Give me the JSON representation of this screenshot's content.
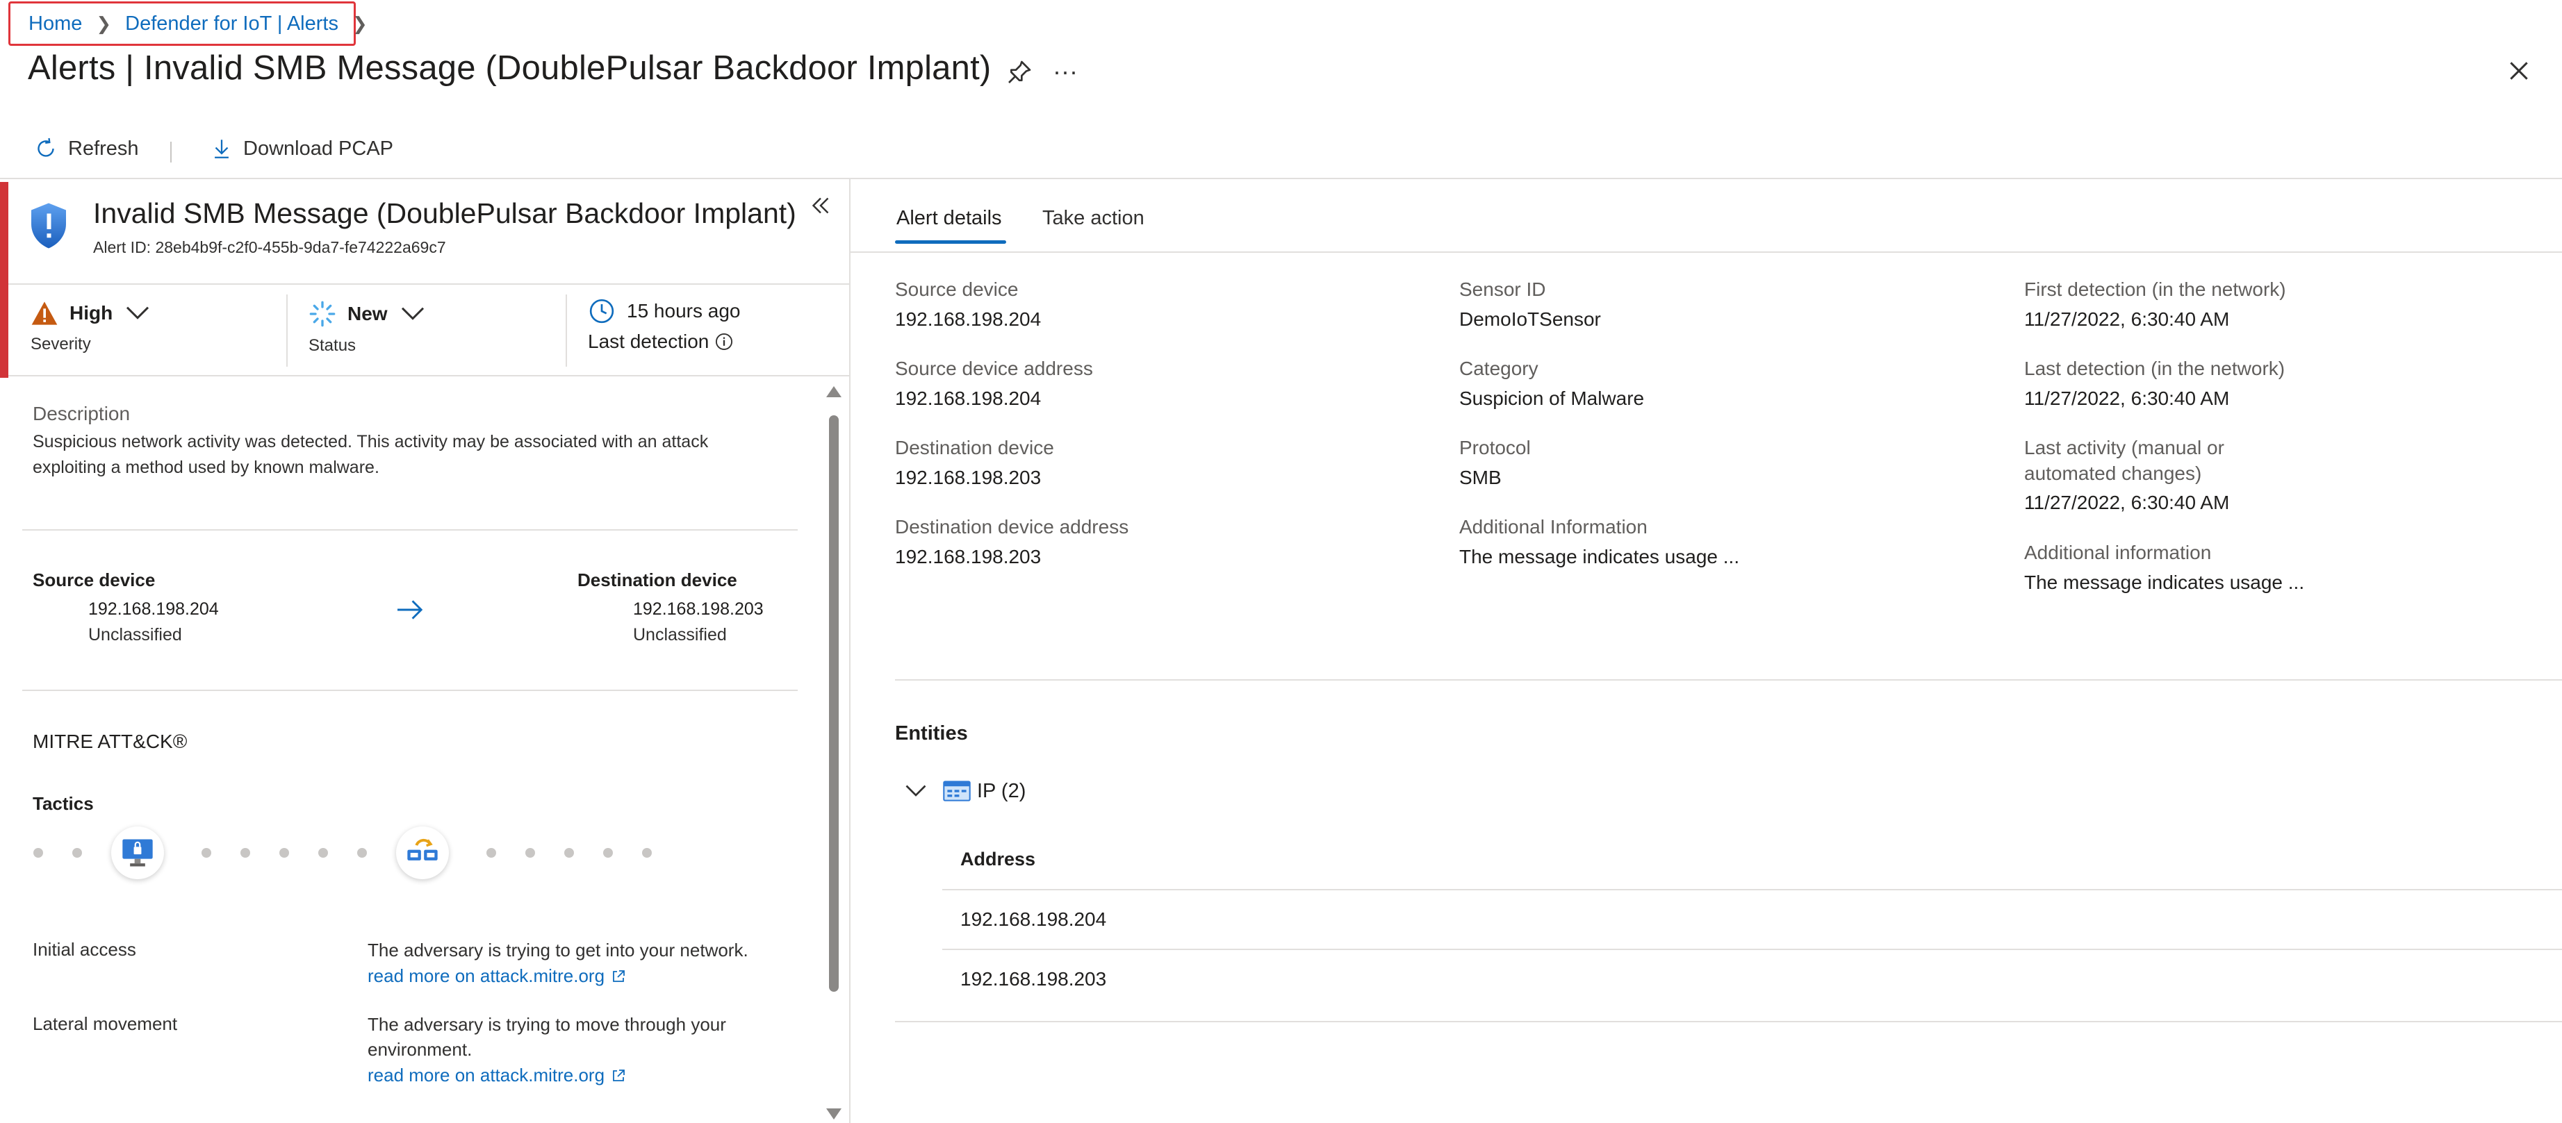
{
  "breadcrumb": {
    "home": "Home",
    "parent": "Defender for IoT | Alerts"
  },
  "header": {
    "title": "Alerts | Invalid SMB Message (DoublePulsar Backdoor Implant)",
    "more": "···"
  },
  "toolbar": {
    "refresh": "Refresh",
    "download": "Download PCAP"
  },
  "alert": {
    "title": "Invalid SMB Message (DoublePulsar Backdoor Implant)",
    "id_text": "Alert ID: 28eb4b9f-c2f0-455b-9da7-fe74222a69c7",
    "severity_value": "High",
    "severity_label": "Severity",
    "status_value": "New",
    "status_label": "Status",
    "last_detection_value": "15 hours ago",
    "last_detection_label": "Last detection",
    "description_label": "Description",
    "description_text": "Suspicious network activity was detected. This activity may be associated with an attack exploiting a method used by known malware.",
    "source": {
      "label": "Source device",
      "ip": "192.168.198.204",
      "class": "Unclassified"
    },
    "destination": {
      "label": "Destination device",
      "ip": "192.168.198.203",
      "class": "Unclassified"
    }
  },
  "mitre": {
    "title": "MITRE ATT&CK®",
    "tactics_label": "Tactics",
    "tactics": [
      {
        "name": "Initial access",
        "desc": "The adversary is trying to get into your network.",
        "link": "read more on attack.mitre.org"
      },
      {
        "name": "Lateral movement",
        "desc": "The adversary is trying to move through your environment.",
        "link": "read more on attack.mitre.org"
      }
    ]
  },
  "tabs": {
    "alert_details": "Alert details",
    "take_action": "Take action"
  },
  "details": {
    "col1": [
      {
        "label": "Source device",
        "value": "192.168.198.204"
      },
      {
        "label": "Source device address",
        "value": "192.168.198.204"
      },
      {
        "label": "Destination device",
        "value": "192.168.198.203"
      },
      {
        "label": "Destination device address",
        "value": "192.168.198.203"
      }
    ],
    "col2": [
      {
        "label": "Sensor ID",
        "value": "DemoIoTSensor"
      },
      {
        "label": "Category",
        "value": "Suspicion of Malware"
      },
      {
        "label": "Protocol",
        "value": "SMB"
      },
      {
        "label": "Additional Information",
        "value": "The message indicates usage ..."
      }
    ],
    "col3": [
      {
        "label": "First detection (in the network)",
        "value": "11/27/2022, 6:30:40 AM"
      },
      {
        "label": "Last detection (in the network)",
        "value": "11/27/2022, 6:30:40 AM"
      },
      {
        "label": "Last activity (manual or automated changes)",
        "label_line1": "Last activity (manual or",
        "label_line2": "automated changes)",
        "value": "11/27/2022, 6:30:40 AM"
      },
      {
        "label": "Additional information",
        "value": "The message indicates usage ..."
      }
    ]
  },
  "entities": {
    "title": "Entities",
    "group_label": "IP (2)",
    "column_header": "Address",
    "rows": [
      "192.168.198.204",
      "192.168.198.203"
    ]
  },
  "colors": {
    "accent": "#0f6cbd",
    "severity_bar": "#d13438",
    "warning": "#c55a11"
  }
}
